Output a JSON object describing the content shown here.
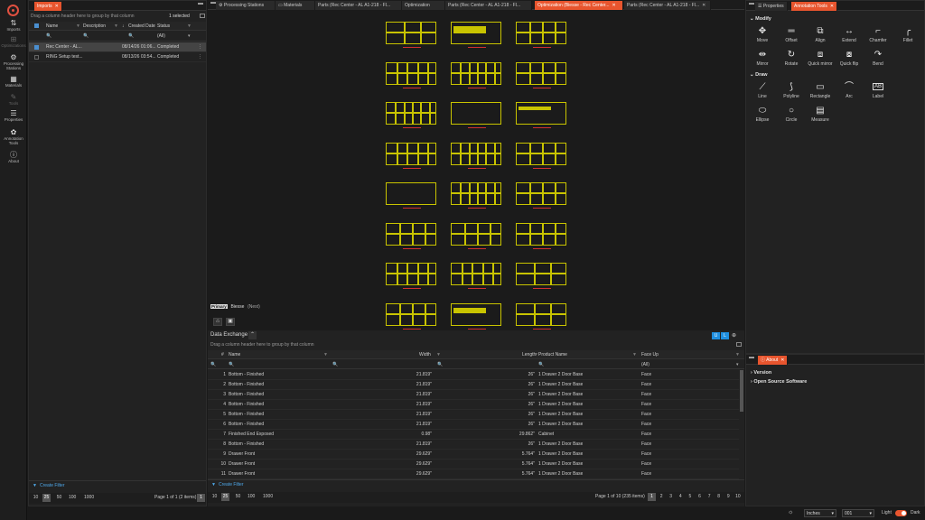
{
  "rail": {
    "items": [
      {
        "label": "Imports",
        "icon": "imports-icon"
      },
      {
        "label": "Optimizations",
        "icon": "optimizations-icon"
      },
      {
        "label": "Processing Stations",
        "icon": "gear-icon"
      },
      {
        "label": "Materials",
        "icon": "materials-icon"
      },
      {
        "label": "Tools",
        "icon": "tools-icon"
      },
      {
        "label": "Properties",
        "icon": "properties-icon"
      },
      {
        "label": "Annotation Tools",
        "icon": "palette-icon"
      },
      {
        "label": "About",
        "icon": "info-icon"
      }
    ]
  },
  "imports": {
    "tab": "Imports",
    "group_hint": "Drag a column header here to group by that column",
    "selected": "1 selected",
    "columns": [
      "Name",
      "Description",
      "Created Date",
      "Status"
    ],
    "status_filter": "(All)",
    "rows": [
      {
        "name": "Rec Center - AL...",
        "description": "",
        "date": "08/14/26 01:06...",
        "status": "Completed"
      },
      {
        "name": "RING Setup test...",
        "description": "",
        "date": "08/13/26 03:54...",
        "status": "Completed"
      }
    ],
    "create_filter": "Create Filter",
    "page_sizes": [
      "10",
      "25",
      "50",
      "100",
      "1000"
    ],
    "page_info": "Page 1 of 1 (2 items)",
    "page_current": "1"
  },
  "center_tabs": [
    {
      "label": "Processing Stations"
    },
    {
      "label": "Materials"
    },
    {
      "label": "Parts (Rec Center - AL A1-218 - Fl..."
    },
    {
      "label": "Optimization"
    },
    {
      "label": "Parts (Rec Center - AL A1-218 - Fl..."
    },
    {
      "label": "Optimization (Biesse - Rec Center..."
    },
    {
      "label": "Parts (Rec Center - AL A1-218 - Fl..."
    }
  ],
  "viewer": {
    "primary_label": "Primary",
    "machine": "Biesse",
    "nest": "(Nest)"
  },
  "data_exchange": {
    "title": "Data Exchange",
    "group_hint": "Drag a column header here to group by that column",
    "columns": [
      "#",
      "Name",
      "Width",
      "Length",
      "Product Name",
      "Face Up"
    ],
    "face_filter": "(All)",
    "rows": [
      {
        "n": "1",
        "name": "Bottom - Finished",
        "width": "21.819\"",
        "length": "26\"",
        "product": "1 Drawer 2 Door Base",
        "face": "Face"
      },
      {
        "n": "2",
        "name": "Bottom - Finished",
        "width": "21.819\"",
        "length": "26\"",
        "product": "1 Drawer 2 Door Base",
        "face": "Face"
      },
      {
        "n": "3",
        "name": "Bottom - Finished",
        "width": "21.819\"",
        "length": "26\"",
        "product": "1 Drawer 2 Door Base",
        "face": "Face"
      },
      {
        "n": "4",
        "name": "Bottom - Finished",
        "width": "21.819\"",
        "length": "26\"",
        "product": "1 Drawer 2 Door Base",
        "face": "Face"
      },
      {
        "n": "5",
        "name": "Bottom - Finished",
        "width": "21.819\"",
        "length": "26\"",
        "product": "1 Drawer 2 Door Base",
        "face": "Face"
      },
      {
        "n": "6",
        "name": "Bottom - Finished",
        "width": "21.819\"",
        "length": "26\"",
        "product": "1 Drawer 2 Door Base",
        "face": "Face"
      },
      {
        "n": "7",
        "name": "Finished End Exposed",
        "width": "0.98\"",
        "length": "29.862\"",
        "product": "Cabinet",
        "face": "Face"
      },
      {
        "n": "8",
        "name": "Bottom - Finished",
        "width": "21.819\"",
        "length": "26\"",
        "product": "1 Drawer 2 Door Base",
        "face": "Face"
      },
      {
        "n": "9",
        "name": "Drawer Front",
        "width": "29.629\"",
        "length": "5.764\"",
        "product": "1 Drawer 2 Door Base",
        "face": "Face"
      },
      {
        "n": "10",
        "name": "Drawer Front",
        "width": "29.629\"",
        "length": "5.764\"",
        "product": "1 Drawer 2 Door Base",
        "face": "Face"
      },
      {
        "n": "11",
        "name": "Drawer Front",
        "width": "29.629\"",
        "length": "5.764\"",
        "product": "1 Drawer 2 Door Base",
        "face": "Face"
      }
    ],
    "create_filter": "Create Filter",
    "page_sizes": [
      "10",
      "25",
      "50",
      "100",
      "1000"
    ],
    "page_info": "Page 1 of 10 (235 items)",
    "pages": [
      "1",
      "2",
      "3",
      "4",
      "5",
      "6",
      "7",
      "8",
      "9",
      "10"
    ]
  },
  "right_tabs": {
    "properties": "Properties",
    "annotation": "Annotation Tools"
  },
  "modify": {
    "title": "Modify",
    "tools": [
      "Move",
      "Offset",
      "Align",
      "Extend",
      "Chamfer",
      "Fillet",
      "Mirror",
      "Rotate",
      "Quick mirror",
      "Quick flip",
      "Bend"
    ]
  },
  "draw": {
    "title": "Draw",
    "tools": [
      "Line",
      "Polyline",
      "Rectangle",
      "Arc",
      "Label",
      "Ellipse",
      "Circle",
      "Measure"
    ]
  },
  "about": {
    "tab": "About",
    "items": [
      "Version",
      "Open Source Software"
    ]
  },
  "status": {
    "units": "Inches",
    "code": "001",
    "light": "Light",
    "dark": "Dark"
  },
  "colors": {
    "accent": "#e8552e",
    "sheet": "#c9c400",
    "link": "#4ea7e8"
  }
}
